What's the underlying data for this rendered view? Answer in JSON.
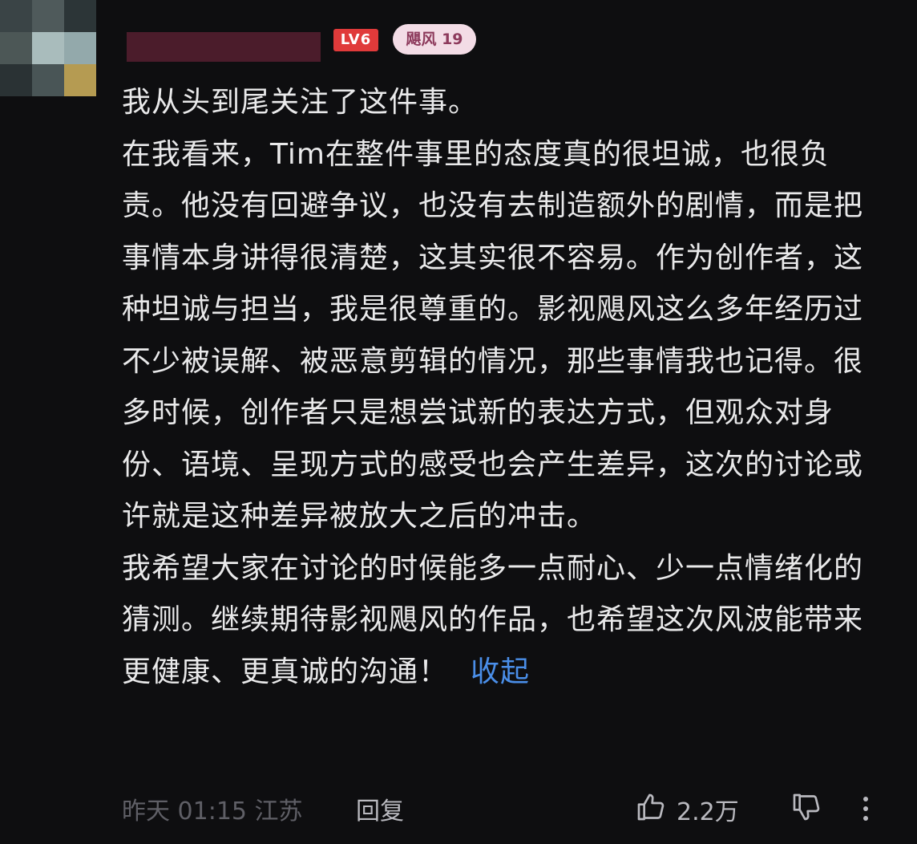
{
  "avatar": {
    "pixels": [
      "#3a4446",
      "#4f5a5b",
      "#2c3537",
      "#4c5756",
      "#a9bcbc",
      "#93a9ab",
      "#2a3234",
      "#495556",
      "#b59b52"
    ]
  },
  "badges": {
    "level": "LV6",
    "fan": "飓风 19",
    "level_color": "#e03a3a",
    "fan_bg_color": "#f3dce6"
  },
  "comment": {
    "paragraphs": [
      "我从头到尾关注了这件事。",
      "在我看来，Tim在整件事里的态度真的很坦诚，也很负责。他没有回避争议，也没有去制造额外的剧情，而是把事情本身讲得很清楚，这其实很不容易。作为创作者，这种坦诚与担当，我是很尊重的。影视飓风这么多年经历过不少被误解、被恶意剪辑的情况，那些事情我也记得。很多时候，创作者只是想尝试新的表达方式，但观众对身份、语境、呈现方式的感受也会产生差异，这次的讨论或许就是这种差异被放大之后的冲击。",
      "我希望大家在讨论的时候能多一点耐心、少一点情绪化的猜测。继续期待影视飓风的作品，也希望这次风波能带来更健康、更真诚的沟通！"
    ],
    "collapse_label": "收起"
  },
  "footer": {
    "time": "昨天 01:15",
    "location": "江苏",
    "reply_label": "回复",
    "like_count": "2.2万",
    "like_icon": "thumbs-up-icon",
    "dislike_icon": "thumbs-down-icon",
    "more_icon": "more-vertical-icon"
  },
  "colors": {
    "background": "#0e0e10",
    "text": "#e9e9ea",
    "link": "#4a8ee8",
    "meta": "#5f5f66",
    "username_redacted": "#4b1c2b"
  }
}
